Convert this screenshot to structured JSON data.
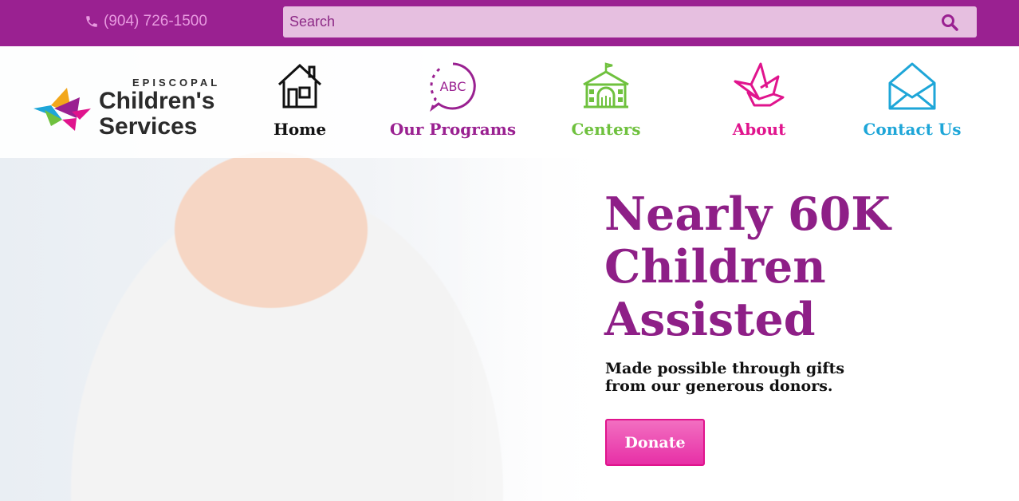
{
  "topbar": {
    "phone": "(904) 726-1500",
    "search_placeholder": "Search"
  },
  "logo": {
    "line1": "EPISCOPAL",
    "line2": "Children's",
    "line3": "Services"
  },
  "nav": [
    {
      "label": "Home",
      "icon": "house-icon",
      "color": "#111111"
    },
    {
      "label": "Our Programs",
      "icon": "abc-chat-icon",
      "color": "#9a2191"
    },
    {
      "label": "Centers",
      "icon": "building-icon",
      "color": "#6fc13e"
    },
    {
      "label": "About",
      "icon": "bird-icon",
      "color": "#e0148d"
    },
    {
      "label": "Contact Us",
      "icon": "envelope-icon",
      "color": "#1ea6d8"
    }
  ],
  "hero": {
    "headline_1": "Nearly 60K",
    "headline_2": "Children",
    "headline_3": "Assisted",
    "sub_1": "Made possible through gifts",
    "sub_2": "from our generous donors.",
    "donate_label": "Donate"
  },
  "colors": {
    "brand_purple": "#9a2191",
    "pink": "#e0148d",
    "green": "#6fc13e",
    "blue": "#1ea6d8"
  }
}
